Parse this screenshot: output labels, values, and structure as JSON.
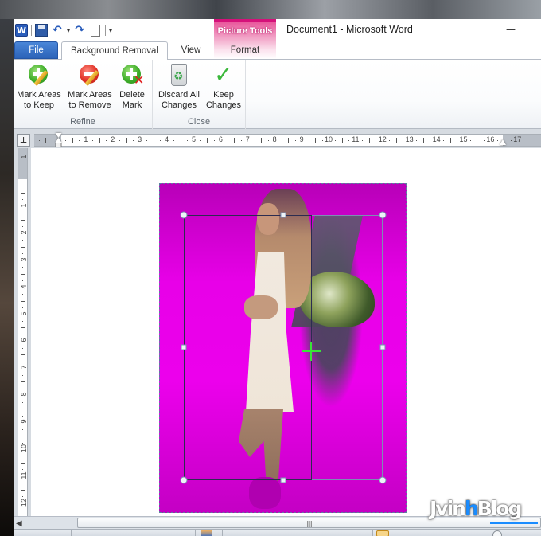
{
  "window": {
    "title": "Document1  -  Microsoft Word",
    "minimize_glyph": "—"
  },
  "quick_access_toolbar": {
    "items": [
      {
        "name": "word-app-icon",
        "glyph": "W"
      },
      {
        "name": "save-icon",
        "glyph": ""
      },
      {
        "name": "undo-icon",
        "glyph": "↶"
      },
      {
        "name": "undo-dropdown-icon",
        "glyph": "▾"
      },
      {
        "name": "redo-icon",
        "glyph": "↷"
      },
      {
        "name": "new-document-icon",
        "glyph": ""
      },
      {
        "name": "customize-toolbar-icon",
        "glyph": "▾"
      }
    ]
  },
  "contextual_group": {
    "label": "Picture Tools",
    "color": "#d5117a"
  },
  "tabs": {
    "file": "File",
    "background_removal": "Background Removal",
    "view": "View",
    "format": "Format",
    "active": "Background Removal"
  },
  "ribbon": {
    "groups": [
      {
        "label": "Refine",
        "buttons": [
          {
            "line1": "Mark Areas",
            "line2": "to Keep",
            "icon": "green-plus-pencil-icon"
          },
          {
            "line1": "Mark Areas",
            "line2": "to Remove",
            "icon": "red-minus-pencil-icon"
          },
          {
            "line1": "Delete",
            "line2": "Mark",
            "icon": "green-plus-red-x-icon"
          }
        ]
      },
      {
        "label": "Close",
        "buttons": [
          {
            "line1": "Discard All",
            "line2": "Changes",
            "icon": "recycle-bin-icon"
          },
          {
            "line1": "Keep",
            "line2": "Changes",
            "icon": "green-check-icon"
          }
        ]
      }
    ]
  },
  "icons": {
    "tab_selector": "⊥",
    "recycle": "♻",
    "check": "✓",
    "xmark": "✕",
    "scroll_left": "◀",
    "scroll_grip": "||||"
  },
  "ruler": {
    "horizontal_numbers": [
      "1",
      "2",
      "3",
      "4",
      "5",
      "6",
      "7",
      "8",
      "9",
      "10",
      "11",
      "12",
      "13",
      "14",
      "15",
      "16",
      "17"
    ],
    "vertical_numbers": [
      "1",
      "1",
      "2",
      "3",
      "4",
      "5",
      "6",
      "7",
      "8",
      "9",
      "10",
      "11",
      "12"
    ]
  },
  "picture": {
    "removal_overlay_color": "#e800e8"
  },
  "watermark": {
    "part1": "Jvin",
    "part2": "h",
    "part3": "Blog",
    "accent_color": "#1a8cff"
  }
}
